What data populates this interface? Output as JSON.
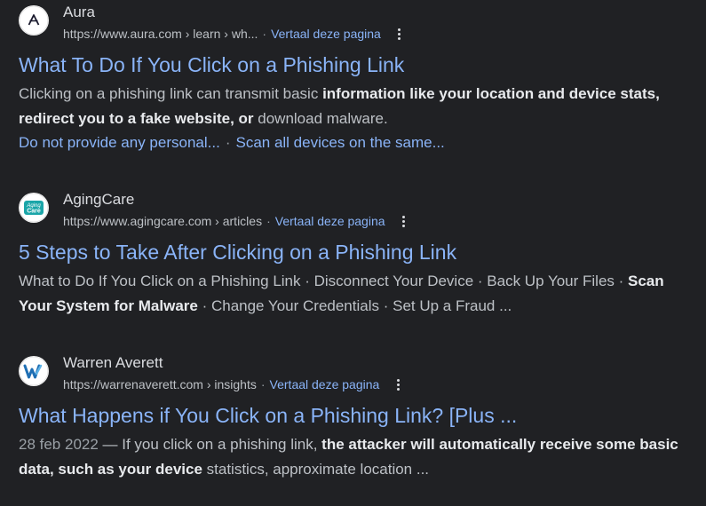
{
  "results": [
    {
      "site_name": "Aura",
      "url": "https://www.aura.com › learn › wh...",
      "translate": "Vertaal deze pagina",
      "title": "What To Do If You Click on a Phishing Link",
      "snippet": {
        "t1": "Clicking on a phishing link can transmit basic ",
        "b1": "information like your location and device stats, redirect you to a fake website, or",
        "t2": " download malware."
      },
      "sitelinks": [
        "Do not provide any personal...",
        "Scan all devices on the same..."
      ],
      "favicon": {
        "icon": "aura-logo-icon",
        "glyph": "Λ",
        "color": "#1a1a2e"
      }
    },
    {
      "site_name": "AgingCare",
      "url": "https://www.agingcare.com › articles",
      "translate": "Vertaal deze pagina",
      "title": "5 Steps to Take After Clicking on a Phishing Link",
      "snippet": {
        "t1": "What to Do If You Click on a Phishing Link · Disconnect Your Device · Back Up Your Files · ",
        "b1": "Scan Your System for Malware",
        "t2": " · Change Your Credentials · Set Up a Fraud ..."
      },
      "favicon": {
        "icon": "agingcare-logo-icon",
        "glyph_top": "Aging",
        "glyph_bottom": "Care",
        "color": "#1aa5a8"
      }
    },
    {
      "site_name": "Warren Averett",
      "url": "https://warrenaverett.com › insights",
      "translate": "Vertaal deze pagina",
      "title": "What Happens if You Click on a Phishing Link? [Plus ...",
      "snippet": {
        "date": "28 feb 2022",
        "dash": " — ",
        "t1": "If you click on a phishing link, ",
        "b1": "the attacker will automatically receive some basic data, such as your device",
        "t2": " statistics, approximate location ..."
      },
      "favicon": {
        "icon": "warren-averett-logo-icon",
        "glyph": "W",
        "color": "#1f6fb4"
      }
    }
  ],
  "sitelink_separator": "·",
  "url_separator": "·",
  "colors": {
    "background": "#202124",
    "link": "#8ab4f8",
    "text": "#bdc1c6",
    "bold_text": "#e8eaed"
  }
}
